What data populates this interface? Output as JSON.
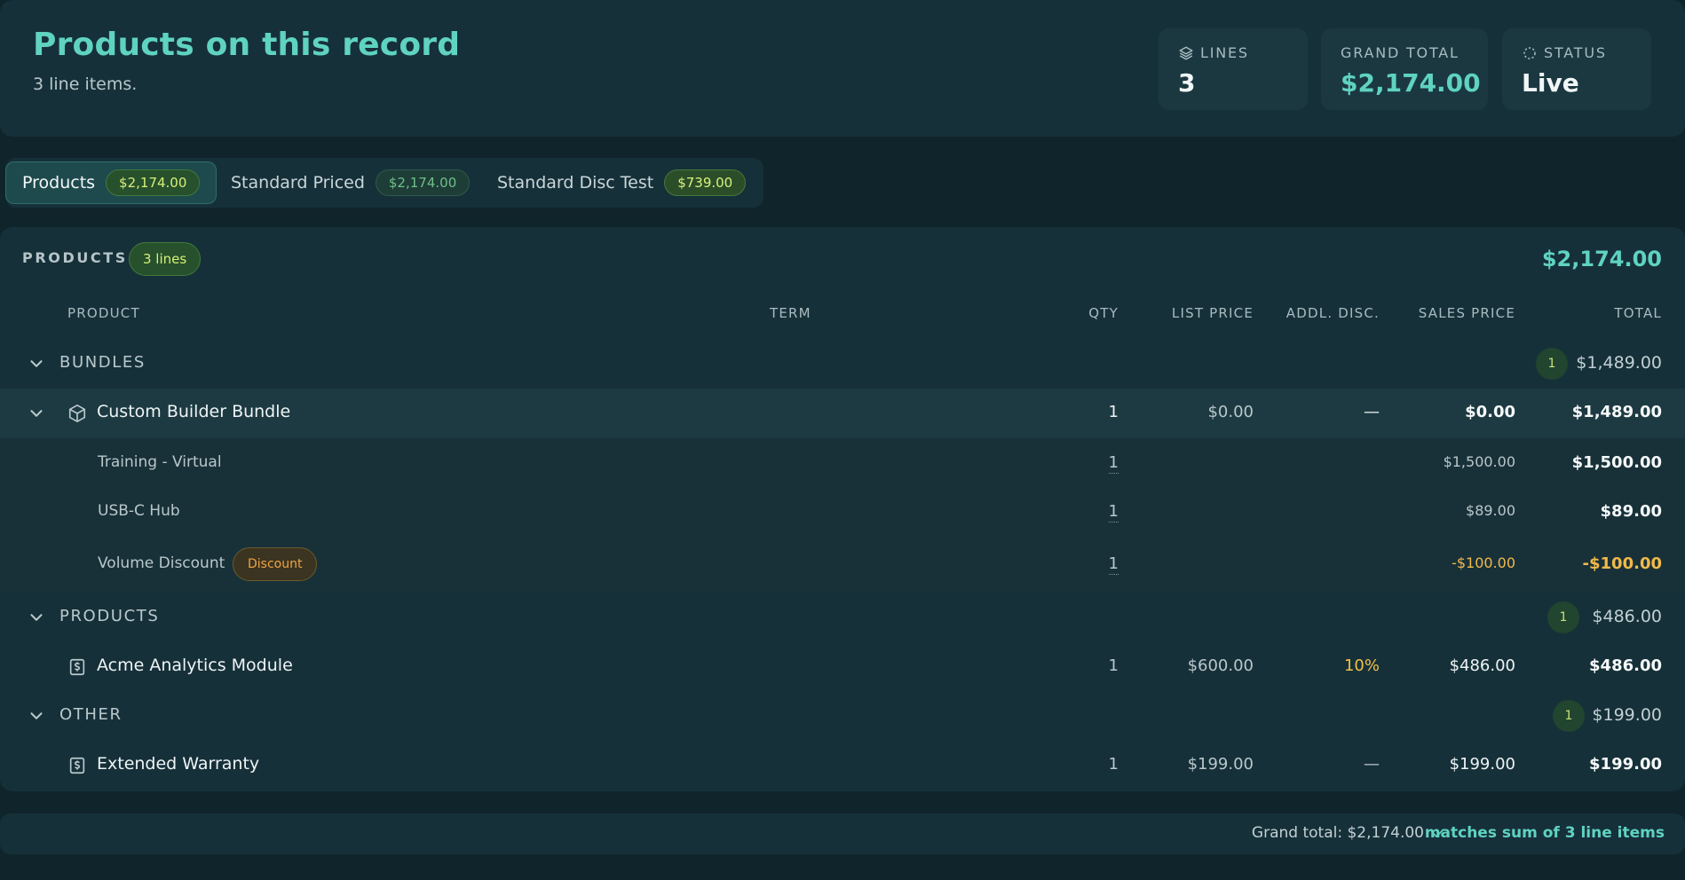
{
  "header": {
    "title": "Products on this record",
    "subtitle": "3 line items.",
    "stats": [
      {
        "label": "LINES",
        "value": "3",
        "icon": "layers-icon"
      },
      {
        "label": "GRAND TOTAL",
        "value": "$2,174.00"
      },
      {
        "label": "STATUS",
        "value": "Live",
        "icon": "dotted-circle-icon"
      }
    ]
  },
  "tabs": [
    {
      "label": "Products",
      "amount": "$2,174.00",
      "active": true
    },
    {
      "label": "Standard Priced",
      "amount": "$2,174.00",
      "active": false
    },
    {
      "label": "Standard Disc Test",
      "amount": "$739.00",
      "active": false
    }
  ],
  "section": {
    "title": "PRODUCTS",
    "count_label": "3 lines",
    "total": "$2,174.00"
  },
  "columns": {
    "product": "PRODUCT",
    "term": "TERM",
    "qty": "QTY",
    "list_price": "LIST PRICE",
    "addl_disc": "ADDL. DISC.",
    "sales_price": "SALES PRICE",
    "total": "TOTAL"
  },
  "groups": {
    "bundles": {
      "name": "BUNDLES",
      "count": "1",
      "total": "$1,489.00"
    },
    "products": {
      "name": "PRODUCTS",
      "count": "1",
      "total": "$486.00"
    },
    "other": {
      "name": "OTHER",
      "count": "1",
      "total": "$199.00"
    }
  },
  "lines": {
    "bundle": {
      "name": "Custom Builder Bundle",
      "qty": "1",
      "list_price": "$0.00",
      "addl_disc": "—",
      "sales_price": "$0.00",
      "total": "$1,489.00"
    },
    "sub1": {
      "name": "Training - Virtual",
      "qty": "1",
      "sales_price": "$1,500.00",
      "total": "$1,500.00"
    },
    "sub2": {
      "name": "USB-C Hub",
      "qty": "1",
      "sales_price": "$89.00",
      "total": "$89.00"
    },
    "sub3": {
      "name": "Volume Discount",
      "badge": "Discount",
      "qty": "1",
      "sales_price": "-$100.00",
      "total": "-$100.00"
    },
    "analytics": {
      "name": "Acme Analytics Module",
      "qty": "1",
      "list_price": "$600.00",
      "addl_disc": "10%",
      "sales_price": "$486.00",
      "total": "$486.00"
    },
    "warranty": {
      "name": "Extended Warranty",
      "qty": "1",
      "list_price": "$199.00",
      "addl_disc": "—",
      "sales_price": "$199.00",
      "total": "$199.00"
    }
  },
  "footer": {
    "grand_total": "Grand total: $2,174.00",
    "match_text": "matches sum of 3 line items"
  },
  "colors": {
    "accent": "#5fd3c0",
    "discount": "#f2b94a",
    "background": "#10252b"
  }
}
